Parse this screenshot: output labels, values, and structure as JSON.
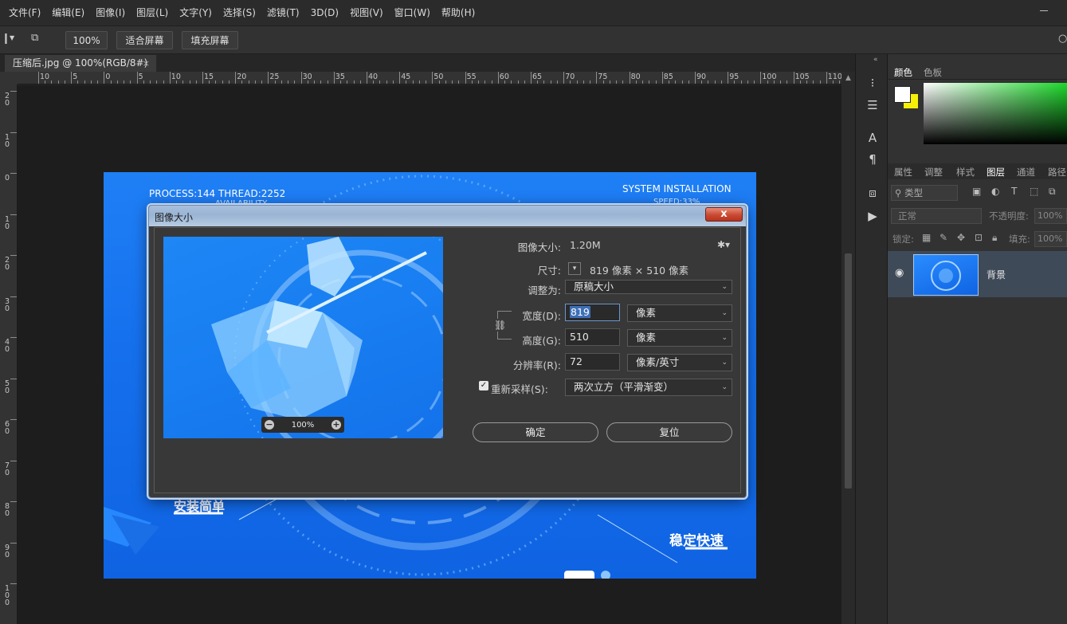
{
  "menu": [
    "文件(F)",
    "编辑(E)",
    "图像(I)",
    "图层(L)",
    "文字(Y)",
    "选择(S)",
    "滤镜(T)",
    "3D(D)",
    "视图(V)",
    "窗口(W)",
    "帮助(H)"
  ],
  "options_bar": {
    "zoom": "100%",
    "fit_screen": "适合屏幕",
    "fill_screen": "填充屏幕"
  },
  "document_tab": {
    "title": "压缩后.jpg @ 100%(RGB/8#)",
    "close": "×"
  },
  "ruler_top": [
    "10",
    "5",
    "0",
    "5",
    "10",
    "15",
    "20",
    "25",
    "30",
    "35",
    "40",
    "45",
    "50",
    "55",
    "60",
    "65",
    "70",
    "75",
    "80",
    "85",
    "90",
    "95",
    "100",
    "105",
    "110"
  ],
  "ruler_left": [
    "20",
    "10",
    "0",
    "10",
    "20",
    "30",
    "40",
    "50",
    "60",
    "70",
    "80",
    "90",
    "100"
  ],
  "canvas": {
    "top_left": "PROCESS:144  THREAD:2252",
    "top_left_sub": "AVAILABILITY",
    "top_right": "SYSTEM INSTALLATION",
    "top_right_sub": "SPEED:33%",
    "bottom_left": "安装简单",
    "bottom_right": "稳定快速"
  },
  "colors": {
    "foreground": "#ffffff",
    "background": "#f5f006",
    "accent_blue": "#1f7ff5"
  },
  "color_panel": {
    "tabs": [
      "颜色",
      "色板"
    ]
  },
  "layers_panel": {
    "tabs": [
      "属性",
      "调整",
      "样式",
      "图层",
      "通道",
      "路径"
    ],
    "filter": "类型",
    "blend_mode": "正常",
    "opacity_label": "不透明度:",
    "opacity": "100%",
    "lock_label": "锁定:",
    "fill_label": "填充:",
    "fill": "100%",
    "layer_name": "背景"
  },
  "dialog": {
    "title": "图像大小",
    "close": "x",
    "image_size_label": "图像大小:",
    "image_size": "1.20M",
    "dimensions_label": "尺寸:",
    "dimensions": "819 像素  ×  510 像素",
    "fit_to_label": "调整为:",
    "fit_to": "原稿大小",
    "width_label": "宽度(D):",
    "width": "819",
    "width_unit": "像素",
    "height_label": "高度(G):",
    "height": "510",
    "height_unit": "像素",
    "resolution_label": "分辨率(R):",
    "resolution": "72",
    "resolution_unit": "像素/英寸",
    "resample_label": "重新采样(S):",
    "resample": "两次立方（平滑渐变）",
    "ok": "确定",
    "reset": "复位",
    "preview_zoom": "100%"
  }
}
